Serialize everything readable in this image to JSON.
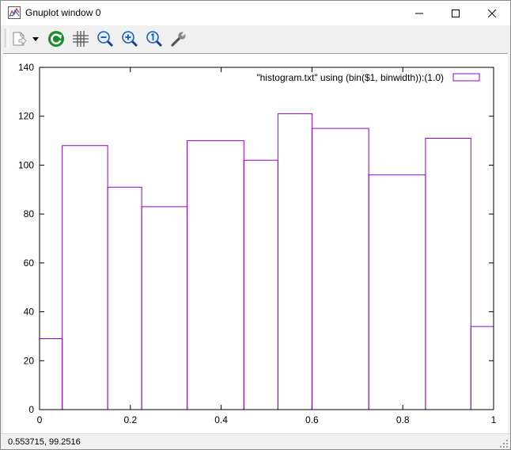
{
  "window": {
    "title": "Gnuplot window 0",
    "controls": {
      "minimize": "minimize",
      "maximize": "maximize",
      "close": "close"
    }
  },
  "toolbar": {
    "buttons": [
      {
        "icon": "copy-dropdown-icon",
        "tooltip": ""
      },
      {
        "icon": "refresh-icon"
      },
      {
        "icon": "grid-icon"
      },
      {
        "icon": "zoom-out-icon"
      },
      {
        "icon": "zoom-in-icon"
      },
      {
        "icon": "zoom-reset-icon"
      },
      {
        "icon": "wrench-icon"
      }
    ]
  },
  "status": {
    "coordinates": "0.553715,  99.2516"
  },
  "colors": {
    "series": "#9400d3",
    "axis": "#000000",
    "toolbar_bg": "#f0f0f0"
  },
  "chart_data": {
    "type": "bar",
    "style": "histogram-steps",
    "title": "",
    "xlabel": "",
    "ylabel": "",
    "xlim": [
      0,
      1
    ],
    "ylim": [
      0,
      140
    ],
    "xticks": [
      "0",
      "0.2",
      "0.4",
      "0.6",
      "0.8",
      "1"
    ],
    "yticks": [
      "0",
      "20",
      "40",
      "60",
      "80",
      "100",
      "120",
      "140"
    ],
    "grid": false,
    "legend_position": "top-right",
    "series": [
      {
        "name": "\"histogram.txt\" using (bin($1, binwidth)):(1.0)",
        "bins": [
          {
            "x0": 0.0,
            "x1": 0.05,
            "count": 29
          },
          {
            "x0": 0.05,
            "x1": 0.15,
            "count": 108
          },
          {
            "x0": 0.15,
            "x1": 0.225,
            "count": 91
          },
          {
            "x0": 0.225,
            "x1": 0.325,
            "count": 83
          },
          {
            "x0": 0.325,
            "x1": 0.45,
            "count": 110
          },
          {
            "x0": 0.45,
            "x1": 0.525,
            "count": 102
          },
          {
            "x0": 0.525,
            "x1": 0.6,
            "count": 121
          },
          {
            "x0": 0.6,
            "x1": 0.725,
            "count": 115
          },
          {
            "x0": 0.725,
            "x1": 0.85,
            "count": 96
          },
          {
            "x0": 0.85,
            "x1": 0.95,
            "count": 111
          },
          {
            "x0": 0.95,
            "x1": 1.0,
            "count": 34
          }
        ]
      }
    ]
  }
}
